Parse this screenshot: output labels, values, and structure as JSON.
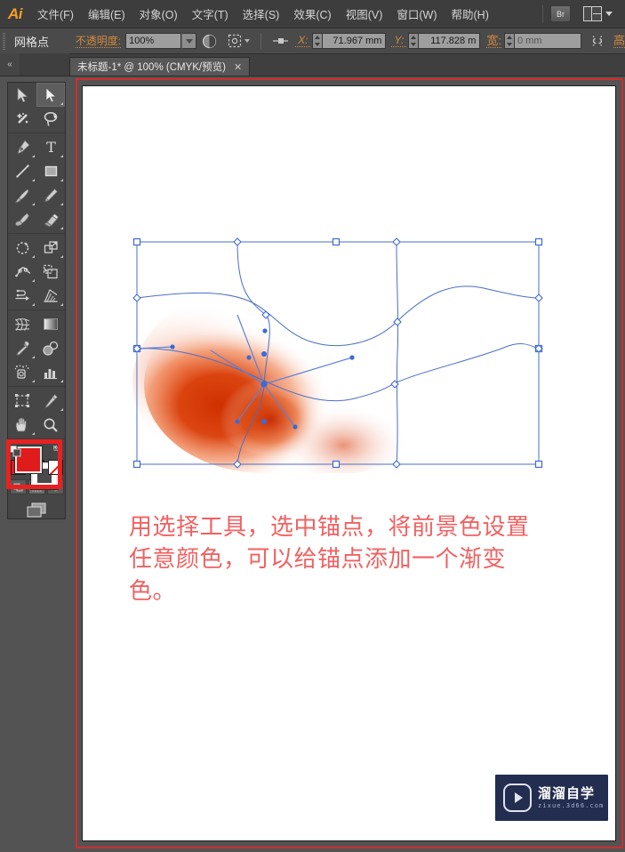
{
  "app": {
    "name": "Ai",
    "logo_text": "Ai"
  },
  "menubar": {
    "items": [
      {
        "label": "文件(F)",
        "name": "menu-file"
      },
      {
        "label": "编辑(E)",
        "name": "menu-edit"
      },
      {
        "label": "对象(O)",
        "name": "menu-object"
      },
      {
        "label": "文字(T)",
        "name": "menu-type"
      },
      {
        "label": "选择(S)",
        "name": "menu-select"
      },
      {
        "label": "效果(C)",
        "name": "menu-effect"
      },
      {
        "label": "视图(V)",
        "name": "menu-view"
      },
      {
        "label": "窗口(W)",
        "name": "menu-window"
      },
      {
        "label": "帮助(H)",
        "name": "menu-help"
      }
    ],
    "bridge_button": "Br",
    "workspace_switcher_icon": "workspace-layout-icon"
  },
  "control_bar": {
    "selection_label": "网格点",
    "opacity_label": "不透明度:",
    "opacity_value": "100%",
    "opacity_dropdown_icon": "chevron-down-icon",
    "transparency_icon": "opacity-sphere-icon",
    "isolation_icon": "isolate-selection-icon",
    "align_icon": "align-icon",
    "x_label": "X:",
    "x_value": "71.967 mm",
    "y_label": "Y:",
    "y_value": "117.828 m",
    "w_label": "宽:",
    "w_value": "0 mm",
    "constrain_icon": "link-broken-icon",
    "h_label": "高"
  },
  "tabstrip": {
    "collapse_icon": "collapse-panel-icon",
    "document_tab": "未标题-1* @ 100% (CMYK/预览)",
    "close_icon": "close-icon"
  },
  "tools": {
    "active_tool": "direct-selection-tool",
    "rows": [
      [
        {
          "name": "selection-tool",
          "label": "选择工具",
          "active": false,
          "corner": false
        },
        {
          "name": "direct-selection-tool",
          "label": "直接选择工具",
          "active": true,
          "corner": true
        }
      ],
      [
        {
          "name": "magic-wand-tool",
          "label": "魔棒工具",
          "active": false,
          "corner": false
        },
        {
          "name": "lasso-tool",
          "label": "套索工具",
          "active": false,
          "corner": false
        }
      ],
      [
        {
          "name": "pen-tool",
          "label": "钢笔工具",
          "active": false,
          "corner": true
        },
        {
          "name": "type-tool",
          "label": "文字工具",
          "active": false,
          "corner": true
        }
      ],
      [
        {
          "name": "line-segment-tool",
          "label": "直线段工具",
          "active": false,
          "corner": true
        },
        {
          "name": "rectangle-tool",
          "label": "矩形工具",
          "active": false,
          "corner": true
        }
      ],
      [
        {
          "name": "paintbrush-tool",
          "label": "画笔工具",
          "active": false,
          "corner": true
        },
        {
          "name": "pencil-tool",
          "label": "铅笔工具",
          "active": false,
          "corner": true
        }
      ],
      [
        {
          "name": "blob-brush-tool",
          "label": "斑点画笔工具",
          "active": false,
          "corner": false
        },
        {
          "name": "eraser-tool",
          "label": "橡皮擦工具",
          "active": false,
          "corner": true
        }
      ],
      [
        {
          "name": "rotate-tool",
          "label": "旋转工具",
          "active": false,
          "corner": true
        },
        {
          "name": "scale-tool",
          "label": "比例缩放工具",
          "active": false,
          "corner": true
        }
      ],
      [
        {
          "name": "width-tool",
          "label": "宽度工具",
          "active": false,
          "corner": true
        },
        {
          "name": "free-transform-tool",
          "label": "自由变换工具",
          "active": false,
          "corner": false
        }
      ],
      [
        {
          "name": "shape-builder-tool",
          "label": "形状生成器工具",
          "active": false,
          "corner": true
        },
        {
          "name": "column-graph-tool",
          "label": "柱形图工具",
          "active": false,
          "corner": true
        }
      ],
      [
        {
          "name": "mesh-tool",
          "label": "网格工具",
          "active": false,
          "corner": false
        },
        {
          "name": "gradient-tool",
          "label": "渐变工具",
          "active": false,
          "corner": false
        }
      ],
      [
        {
          "name": "eyedropper-tool",
          "label": "吸管工具",
          "active": false,
          "corner": true
        },
        {
          "name": "blend-tool",
          "label": "混合工具",
          "active": false,
          "corner": false
        }
      ],
      [
        {
          "name": "symbol-sprayer-tool",
          "label": "符号喷枪工具",
          "active": false,
          "corner": true
        },
        {
          "name": "graph-tool",
          "label": "图表工具",
          "active": false,
          "corner": true
        }
      ],
      [
        {
          "name": "artboard-tool",
          "label": "画板工具",
          "active": false,
          "corner": false
        },
        {
          "name": "slice-tool",
          "label": "切片工具",
          "active": false,
          "corner": true
        }
      ],
      [
        {
          "name": "hand-tool",
          "label": "抓手工具",
          "active": false,
          "corner": true
        },
        {
          "name": "zoom-tool",
          "label": "缩放工具",
          "active": false,
          "corner": false
        }
      ]
    ],
    "fill_color": "#e01b1b",
    "stroke_color": "#ffffff",
    "fill_swatch_name": "fill-color-swatch",
    "stroke_swatch_name": "stroke-color-swatch",
    "swap_icon": "swap-fill-stroke-icon",
    "default_icon": "default-fill-stroke-icon",
    "color_modes": [
      {
        "name": "color-mode-solid",
        "label": "颜色"
      },
      {
        "name": "color-mode-gradient",
        "label": "渐变"
      },
      {
        "name": "color-mode-none",
        "label": "无"
      }
    ],
    "draw_modes": [
      {
        "name": "draw-normal-mode",
        "selected": false
      },
      {
        "name": "draw-behind-mode",
        "selected": true
      },
      {
        "name": "draw-inside-mode",
        "selected": false
      }
    ],
    "screen_mode_icon": "screen-mode-icon"
  },
  "annotations": {
    "fill_highlight_color": "#ea2020",
    "document_frame_color": "#d42b2b",
    "text_color": "#f06161",
    "instruction_text": "用选择工具，选中锚点，将前景色设置任意颜色，可以给锚点添加一个渐变色。"
  },
  "artwork": {
    "name": "gradient-mesh-object",
    "mesh_line_color": "#4a6fc4",
    "anchor_color": "#3c6ad4",
    "gradient_colors": [
      "#cf3000",
      "#e8592a",
      "#ffffff"
    ],
    "description": "渐变网格对象"
  },
  "watermark": {
    "brand": "溜溜自学",
    "url": "zixue.3d66.com",
    "logo_icon": "play-button-icon",
    "background": "#232d4f"
  }
}
